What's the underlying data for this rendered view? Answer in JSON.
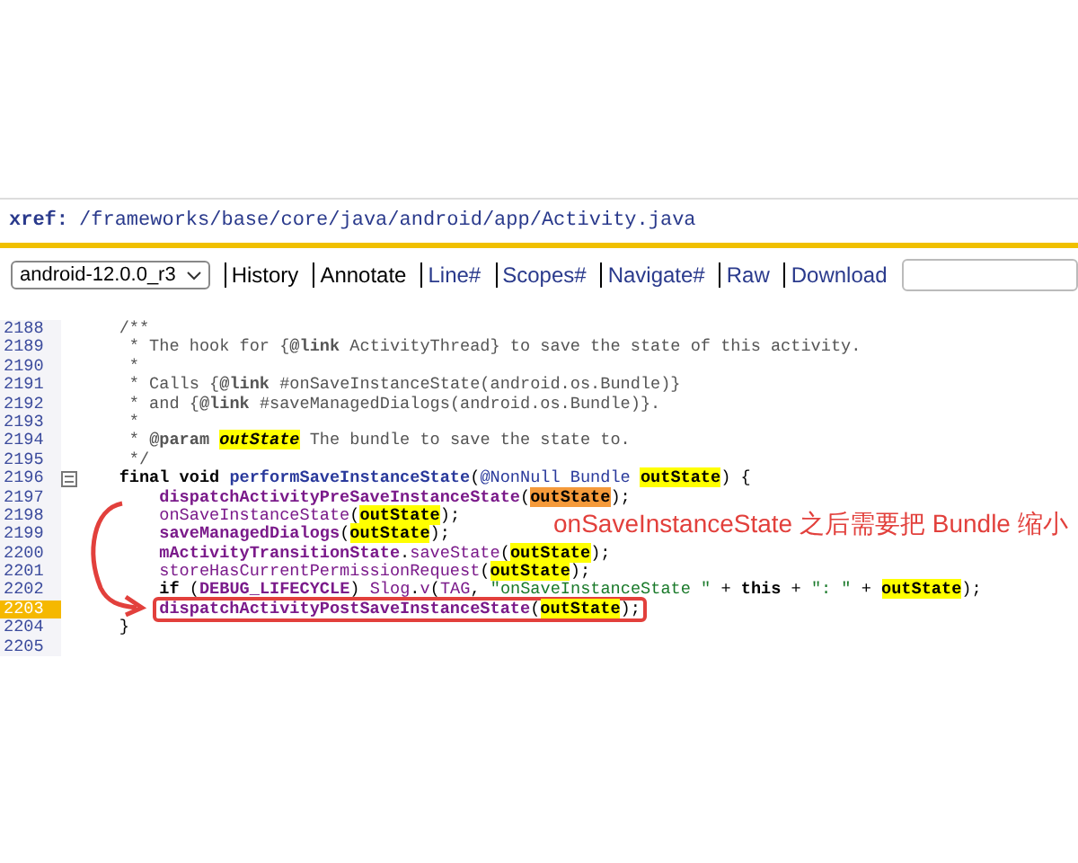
{
  "header": {
    "label": "xref:",
    "path": "/frameworks/base/core/java/android/app/Activity.java"
  },
  "toolbar": {
    "version": "android-12.0.0_r3",
    "links": [
      {
        "label": "History",
        "kind": "plain"
      },
      {
        "label": "Annotate",
        "kind": "plain"
      },
      {
        "label": "Line#",
        "kind": "link"
      },
      {
        "label": "Scopes#",
        "kind": "link"
      },
      {
        "label": "Navigate#",
        "kind": "link"
      },
      {
        "label": "Raw",
        "kind": "link"
      },
      {
        "label": "Download",
        "kind": "link"
      }
    ]
  },
  "code": [
    {
      "number": "2188",
      "current": false,
      "marked": false,
      "tokens": [
        {
          "kind": "comment",
          "text": "    /**"
        }
      ]
    },
    {
      "number": "2189",
      "current": false,
      "marked": false,
      "tokens": [
        {
          "kind": "comment",
          "text": "     * The hook for {"
        },
        {
          "kind": "tag",
          "text": "@link"
        },
        {
          "kind": "comment",
          "text": " ActivityThread} to save the state of this activity."
        }
      ]
    },
    {
      "number": "2190",
      "current": false,
      "marked": false,
      "tokens": [
        {
          "kind": "comment",
          "text": "     *"
        }
      ]
    },
    {
      "number": "2191",
      "current": false,
      "marked": false,
      "tokens": [
        {
          "kind": "comment",
          "text": "     * Calls {"
        },
        {
          "kind": "tag",
          "text": "@link"
        },
        {
          "kind": "comment",
          "text": " #onSaveInstanceState(android.os.Bundle)}"
        }
      ]
    },
    {
      "number": "2192",
      "current": false,
      "marked": false,
      "tokens": [
        {
          "kind": "comment",
          "text": "     * and {"
        },
        {
          "kind": "tag",
          "text": "@link"
        },
        {
          "kind": "comment",
          "text": " #saveManagedDialogs(android.os.Bundle)}."
        }
      ]
    },
    {
      "number": "2193",
      "current": false,
      "marked": false,
      "tokens": [
        {
          "kind": "comment",
          "text": "     *"
        }
      ]
    },
    {
      "number": "2194",
      "current": false,
      "marked": false,
      "tokens": [
        {
          "kind": "comment",
          "text": "     * "
        },
        {
          "kind": "tag",
          "text": "@param "
        },
        {
          "kind": "param",
          "text": "outState"
        },
        {
          "kind": "comment",
          "text": " The bundle to save the state to."
        }
      ]
    },
    {
      "number": "2195",
      "current": false,
      "marked": false,
      "tokens": [
        {
          "kind": "comment",
          "text": "     */"
        }
      ]
    },
    {
      "number": "2196",
      "current": false,
      "marked": false,
      "fold": true,
      "tokens": [
        {
          "kind": "keyword",
          "text": "    final void "
        },
        {
          "kind": "def",
          "text": "performSaveInstanceState"
        },
        {
          "kind": "plain",
          "text": "("
        },
        {
          "kind": "type",
          "text": "@NonNull Bundle "
        },
        {
          "kind": "highlight",
          "text": "outState"
        },
        {
          "kind": "plain",
          "text": ") {"
        }
      ]
    },
    {
      "number": "2197",
      "current": false,
      "marked": false,
      "tokens": [
        {
          "kind": "call-bold",
          "text": "        dispatchActivityPreSaveInstanceState"
        },
        {
          "kind": "plain",
          "text": "("
        },
        {
          "kind": "match",
          "text": "outState"
        },
        {
          "kind": "plain",
          "text": ");"
        }
      ]
    },
    {
      "number": "2198",
      "current": false,
      "marked": false,
      "tokens": [
        {
          "kind": "call",
          "text": "        onSaveInstanceState"
        },
        {
          "kind": "plain",
          "text": "("
        },
        {
          "kind": "highlight",
          "text": "outState"
        },
        {
          "kind": "plain",
          "text": ");"
        }
      ]
    },
    {
      "number": "2199",
      "current": false,
      "marked": false,
      "tokens": [
        {
          "kind": "call-bold",
          "text": "        saveManagedDialogs"
        },
        {
          "kind": "plain",
          "text": "("
        },
        {
          "kind": "highlight",
          "text": "outState"
        },
        {
          "kind": "plain",
          "text": ");"
        }
      ]
    },
    {
      "number": "2200",
      "current": false,
      "marked": false,
      "tokens": [
        {
          "kind": "call-bold",
          "text": "        mActivityTransitionState"
        },
        {
          "kind": "plain",
          "text": "."
        },
        {
          "kind": "call",
          "text": "saveState"
        },
        {
          "kind": "plain",
          "text": "("
        },
        {
          "kind": "highlight",
          "text": "outState"
        },
        {
          "kind": "plain",
          "text": ");"
        }
      ]
    },
    {
      "number": "2201",
      "current": false,
      "marked": false,
      "tokens": [
        {
          "kind": "call",
          "text": "        storeHasCurrentPermissionRequest"
        },
        {
          "kind": "plain",
          "text": "("
        },
        {
          "kind": "highlight",
          "text": "outState"
        },
        {
          "kind": "plain",
          "text": ");"
        }
      ]
    },
    {
      "number": "2202",
      "current": false,
      "marked": false,
      "tokens": [
        {
          "kind": "keyword",
          "text": "        if"
        },
        {
          "kind": "plain",
          "text": " ("
        },
        {
          "kind": "call-bold",
          "text": "DEBUG_LIFECYCLE"
        },
        {
          "kind": "plain",
          "text": ") "
        },
        {
          "kind": "call",
          "text": "Slog"
        },
        {
          "kind": "plain",
          "text": "."
        },
        {
          "kind": "call",
          "text": "v"
        },
        {
          "kind": "plain",
          "text": "("
        },
        {
          "kind": "call",
          "text": "TAG"
        },
        {
          "kind": "plain",
          "text": ", "
        },
        {
          "kind": "string",
          "text": "\"onSaveInstanceState \""
        },
        {
          "kind": "plain",
          "text": " + "
        },
        {
          "kind": "keyword",
          "text": "this"
        },
        {
          "kind": "plain",
          "text": " + "
        },
        {
          "kind": "string",
          "text": "\": \""
        },
        {
          "kind": "plain",
          "text": " + "
        },
        {
          "kind": "highlight",
          "text": "outState"
        },
        {
          "kind": "plain",
          "text": ");"
        }
      ]
    },
    {
      "number": "2203",
      "current": true,
      "marked": true,
      "tokens": [
        {
          "kind": "call-bold",
          "text": "        dispatchActivityPostSaveInstanceState"
        },
        {
          "kind": "plain",
          "text": "("
        },
        {
          "kind": "highlight",
          "text": "outState"
        },
        {
          "kind": "plain",
          "text": ");"
        }
      ]
    },
    {
      "number": "2204",
      "current": false,
      "marked": false,
      "tokens": [
        {
          "kind": "plain",
          "text": "    }"
        }
      ]
    },
    {
      "number": "2205",
      "current": false,
      "marked": false
    }
  ],
  "annotation": {
    "text": "onSaveInstanceState 之后需要把 Bundle 缩小"
  }
}
